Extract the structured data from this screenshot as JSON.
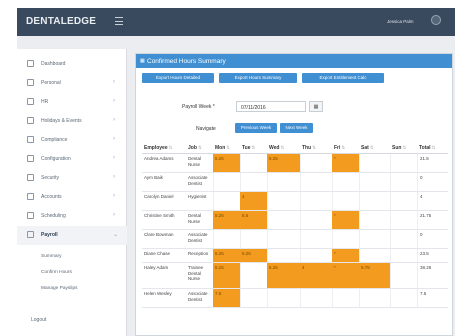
{
  "app": {
    "brand": "DENTALEDGE",
    "user_name": "Jessica Palm"
  },
  "sidebar": {
    "items": [
      {
        "label": "Dashboard",
        "chevron": ""
      },
      {
        "label": "Personal",
        "chevron": "›"
      },
      {
        "label": "HR",
        "chevron": "›"
      },
      {
        "label": "Holidays & Events",
        "chevron": "›"
      },
      {
        "label": "Compliance",
        "chevron": "›"
      },
      {
        "label": "Configuration",
        "chevron": "›"
      },
      {
        "label": "Security",
        "chevron": "›"
      },
      {
        "label": "Accounts",
        "chevron": "›"
      },
      {
        "label": "Scheduling",
        "chevron": "›"
      },
      {
        "label": "Payroll",
        "chevron": "⌄"
      }
    ],
    "sub_items": [
      "Summary",
      "Confirm Hours",
      "Manage Payslips"
    ],
    "logout": "Logout"
  },
  "panel": {
    "title": "Confirmed Hours Summary",
    "buttons": [
      "Export Hours Detailed",
      "Export Hours Summary",
      "Export Entitlement Calc"
    ],
    "payroll_week_label": "Payroll Week *",
    "payroll_week_value": "07/11/2016",
    "navigate_label": "Navigate",
    "prev_week": "Previous Week",
    "next_week": "Next Week"
  },
  "table": {
    "headers": [
      "Employee",
      "Job",
      "Mon",
      "Tue",
      "Wed",
      "Thu",
      "Fri",
      "Sat",
      "Sun",
      "Total"
    ],
    "rows": [
      {
        "employee": "Andrea Adams",
        "job": "Dental Nurse",
        "days": [
          "5.25",
          "",
          "5.25",
          "",
          "*",
          "",
          ""
        ],
        "total": "21.5"
      },
      {
        "employee": "Aym Baik",
        "job": "Associate Dentist",
        "days": [
          "",
          "",
          "",
          "",
          "",
          "",
          ""
        ],
        "total": "0"
      },
      {
        "employee": "Carolyn Daniel",
        "job": "Hygienist",
        "days": [
          "",
          "4",
          "",
          "",
          "",
          "",
          ""
        ],
        "total": "4"
      },
      {
        "employee": "Christine Smith",
        "job": "Dental Nurse",
        "days": [
          "5.25",
          "5.5",
          "",
          "",
          "*",
          "",
          ""
        ],
        "total": "21.75"
      },
      {
        "employee": "Clare Bowman",
        "job": "Associate Dentist",
        "days": [
          "",
          "",
          "",
          "",
          "",
          "",
          ""
        ],
        "total": "0"
      },
      {
        "employee": "Diane Chase",
        "job": "Reception",
        "days": [
          "5.25",
          "5.25",
          "",
          "",
          "*",
          "",
          ""
        ],
        "total": "23.5"
      },
      {
        "employee": "Haley Adam",
        "job": "Trainee Dental Nurse",
        "days": [
          "5.25",
          "",
          "5.25",
          "4",
          "*",
          "5.75",
          ""
        ],
        "total": "38.25"
      },
      {
        "employee": "Helen Wesley",
        "job": "Associate Dentist",
        "days": [
          "7.5",
          "",
          "",
          "",
          "",
          "",
          ""
        ],
        "total": "7.5"
      }
    ]
  },
  "colors": {
    "topbar": "#3a4a5e",
    "accent": "#3f8fd2",
    "shift": "#f29b1e"
  }
}
